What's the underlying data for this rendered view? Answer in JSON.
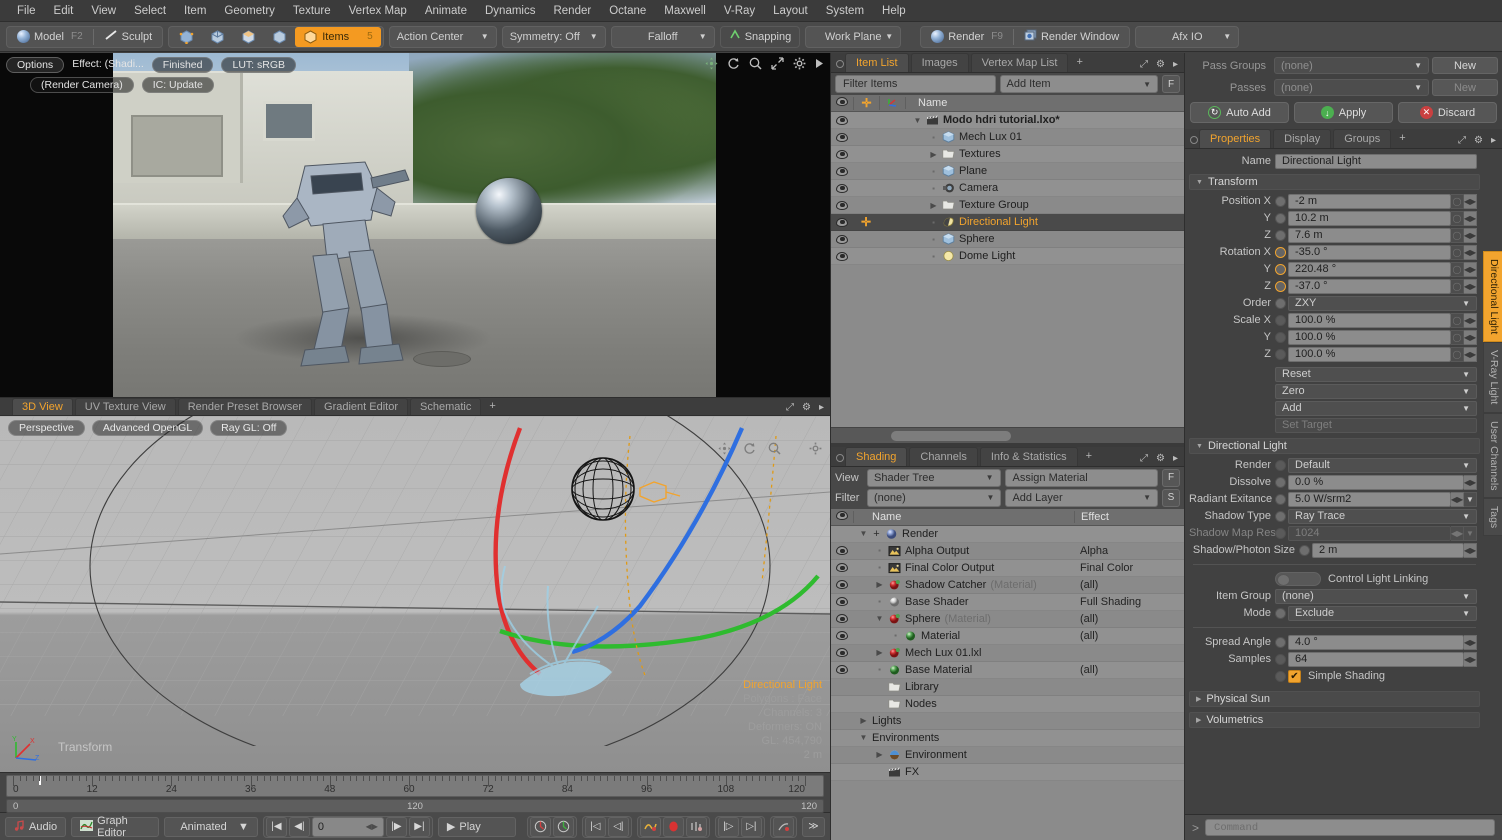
{
  "menu": {
    "items": [
      "File",
      "Edit",
      "View",
      "Select",
      "Item",
      "Geometry",
      "Texture",
      "Vertex Map",
      "Animate",
      "Dynamics",
      "Render",
      "Octane",
      "Maxwell",
      "V-Ray",
      "Layout",
      "System",
      "Help"
    ]
  },
  "toolbar": {
    "model_label": "Model",
    "model_hotkey": "F2",
    "sculpt_label": "Sculpt",
    "items_label": "Items",
    "items_count": "5",
    "action_center": "Action Center",
    "symmetry": "Symmetry: Off",
    "falloff": "Falloff",
    "snapping": "Snapping",
    "work_plane": "Work Plane",
    "render_label": "Render",
    "render_hotkey": "F9",
    "render_window_label": "Render Window",
    "afx_io": "Afx IO"
  },
  "render_preview": {
    "options": "Options",
    "effect": "Effect: (Shadi...",
    "status": "Finished",
    "lut": "LUT: sRGB",
    "camera": "(Render Camera)",
    "ic": "IC: Update"
  },
  "viewport": {
    "tabs": [
      "3D View",
      "UV Texture View",
      "Render Preset Browser",
      "Gradient Editor",
      "Schematic"
    ],
    "active_tab": "3D View",
    "add_tab": "+",
    "sub_buttons": [
      "Perspective",
      "Advanced OpenGL",
      "Ray GL: Off"
    ],
    "transform_label": "Transform",
    "info": {
      "title": "Directional Light",
      "polygons": "Polygons : Face",
      "channels": "Channels: 3",
      "deformers": "Deformers: ON",
      "gl": "GL: 454,790",
      "scale": "2 m"
    }
  },
  "timeline": {
    "ticks": [
      "0",
      "12",
      "24",
      "36",
      "48",
      "60",
      "72",
      "84",
      "96",
      "108",
      "120"
    ],
    "range_start": "0",
    "range_center": "120",
    "range_end": "120"
  },
  "statusbar": {
    "audio": "Audio",
    "graph_editor": "Graph Editor",
    "mode": "Animated",
    "frame": "0",
    "play": "Play"
  },
  "item_list": {
    "tabs": [
      "Item List",
      "Images",
      "Vertex Map List"
    ],
    "active_tab": "Item List",
    "add_tab": "+",
    "filter_placeholder": "Filter Items",
    "add_item": "Add Item",
    "f_button": "F",
    "columns": [
      "Name"
    ],
    "rows": [
      {
        "name": "Modo hdri tutorial.lxo*",
        "icon": "scene-icon",
        "depth": 0,
        "bold": true,
        "expander": "down",
        "selected": false
      },
      {
        "name": "Mech Lux 01",
        "icon": "mesh-icon",
        "depth": 1,
        "bold": false,
        "expander": "leaf",
        "selected": false
      },
      {
        "name": "Textures",
        "icon": "folder-icon",
        "depth": 1,
        "bold": false,
        "expander": "right",
        "selected": false
      },
      {
        "name": "Plane",
        "icon": "mesh-icon",
        "depth": 1,
        "bold": false,
        "expander": "leaf",
        "selected": false
      },
      {
        "name": "Camera",
        "icon": "camera-icon",
        "depth": 1,
        "bold": false,
        "expander": "leaf",
        "selected": false
      },
      {
        "name": "Texture Group",
        "icon": "folder-icon",
        "depth": 1,
        "bold": false,
        "expander": "right",
        "selected": false
      },
      {
        "name": "Directional Light",
        "icon": "light-icon",
        "depth": 1,
        "bold": false,
        "expander": "leaf",
        "selected": true
      },
      {
        "name": "Sphere",
        "icon": "mesh-icon",
        "depth": 1,
        "bold": false,
        "expander": "leaf",
        "selected": false
      },
      {
        "name": "Dome Light",
        "icon": "dome-icon",
        "depth": 1,
        "bold": false,
        "expander": "leaf",
        "selected": false
      }
    ]
  },
  "shading": {
    "tabs": [
      "Shading",
      "Channels",
      "Info & Statistics"
    ],
    "active_tab": "Shading",
    "add_tab": "+",
    "view_label": "View",
    "view_value": "Shader Tree",
    "assign_material": "Assign Material",
    "f_button": "F",
    "filter_label": "Filter",
    "filter_value": "(none)",
    "add_layer": "Add Layer",
    "s_button": "S",
    "columns": [
      "Name",
      "Effect"
    ],
    "rows": [
      {
        "name": "Render",
        "sub": "",
        "effect": "",
        "icon": "render-globe-icon",
        "depth": 0,
        "expander": "down",
        "eye": false,
        "plus": true
      },
      {
        "name": "Alpha Output",
        "sub": "",
        "effect": "Alpha",
        "icon": "image-icon",
        "depth": 1,
        "expander": "leaf",
        "eye": true
      },
      {
        "name": "Final Color Output",
        "sub": "",
        "effect": "Final Color",
        "icon": "image-icon",
        "depth": 1,
        "expander": "leaf",
        "eye": true
      },
      {
        "name": "Shadow Catcher",
        "sub": "(Material)",
        "effect": "(all)",
        "icon": "material-red-icon",
        "depth": 1,
        "expander": "right",
        "eye": true
      },
      {
        "name": "Base Shader",
        "sub": "",
        "effect": "Full Shading",
        "icon": "shader-icon",
        "depth": 1,
        "expander": "leaf",
        "eye": true
      },
      {
        "name": "Sphere",
        "sub": "(Material)",
        "effect": "(all)",
        "icon": "material-red-icon",
        "depth": 1,
        "expander": "down",
        "eye": true
      },
      {
        "name": "Material",
        "sub": "",
        "effect": "(all)",
        "icon": "material-green-icon",
        "depth": 2,
        "expander": "leaf",
        "eye": true
      },
      {
        "name": "Mech Lux 01.lxl",
        "sub": "",
        "effect": "",
        "icon": "material-red-icon",
        "depth": 1,
        "expander": "right",
        "eye": true
      },
      {
        "name": "Base Material",
        "sub": "",
        "effect": "(all)",
        "icon": "material-green-icon",
        "depth": 1,
        "expander": "leaf",
        "eye": true
      },
      {
        "name": "Library",
        "sub": "",
        "effect": "",
        "icon": "folder-icon",
        "depth": 1,
        "expander": "none",
        "eye": false
      },
      {
        "name": "Nodes",
        "sub": "",
        "effect": "",
        "icon": "folder-icon",
        "depth": 1,
        "expander": "none",
        "eye": false
      },
      {
        "name": "Lights",
        "sub": "",
        "effect": "",
        "icon": "none",
        "depth": 0,
        "expander": "right",
        "eye": false
      },
      {
        "name": "Environments",
        "sub": "",
        "effect": "",
        "icon": "none",
        "depth": 0,
        "expander": "down",
        "eye": false
      },
      {
        "name": "Environment",
        "sub": "",
        "effect": "",
        "icon": "env-icon",
        "depth": 1,
        "expander": "right",
        "eye": false
      },
      {
        "name": "FX",
        "sub": "",
        "effect": "",
        "icon": "scene-icon",
        "depth": 1,
        "expander": "none",
        "eye": false
      }
    ]
  },
  "properties": {
    "pass_groups_label": "Pass Groups",
    "pass_groups_value": "(none)",
    "pass_groups_new": "New",
    "passes_label": "Passes",
    "passes_value": "(none)",
    "passes_new": "New",
    "auto_add": "Auto Add",
    "apply": "Apply",
    "discard": "Discard",
    "tabs": [
      "Properties",
      "Display",
      "Groups"
    ],
    "active_tab": "Properties",
    "add_tab": "+",
    "name_label": "Name",
    "name_value": "Directional Light",
    "transform_title": "Transform",
    "transform": [
      {
        "label": "Position X",
        "value": "-2 m",
        "knob": "normal"
      },
      {
        "label": "Y",
        "value": "10.2 m",
        "knob": "normal"
      },
      {
        "label": "Z",
        "value": "7.6 m",
        "knob": "normal"
      },
      {
        "label": "Rotation X",
        "value": "-35.0 °",
        "knob": "on"
      },
      {
        "label": "Y",
        "value": "220.48 °",
        "knob": "on"
      },
      {
        "label": "Z",
        "value": "-37.0 °",
        "knob": "on"
      }
    ],
    "order_label": "Order",
    "order_value": "ZXY",
    "scale": [
      {
        "label": "Scale X",
        "value": "100.0 %"
      },
      {
        "label": "Y",
        "value": "100.0 %"
      },
      {
        "label": "Z",
        "value": "100.0 %"
      }
    ],
    "reset": "Reset",
    "zero": "Zero",
    "add": "Add",
    "set_target": "Set Target",
    "light_title": "Directional Light",
    "render_label": "Render",
    "render_value": "Default",
    "dissolve_label": "Dissolve",
    "dissolve_value": "0.0 %",
    "radiant_label": "Radiant Exitance",
    "radiant_value": "5.0 W/srm2",
    "shadow_type_label": "Shadow Type",
    "shadow_type_value": "Ray Trace",
    "shadow_map_label": "Shadow Map Res",
    "shadow_map_value": "1024",
    "shadow_photon_label": "Shadow/Photon Size",
    "shadow_photon_value": "2 m",
    "control_light_linking": "Control Light Linking",
    "item_group_label": "Item Group",
    "item_group_value": "(none)",
    "mode_label": "Mode",
    "mode_value": "Exclude",
    "spread_label": "Spread Angle",
    "spread_value": "4.0 °",
    "samples_label": "Samples",
    "samples_value": "64",
    "simple_shading": "Simple Shading",
    "physical_sun": "Physical Sun",
    "volumetrics": "Volumetrics",
    "vertical_tabs": [
      "Directional Light",
      "V-Ray Light",
      "User Channels",
      "Tags"
    ],
    "vertical_active": "Directional Light"
  },
  "command": {
    "prompt": ">",
    "placeholder": "Command"
  },
  "colors": {
    "accent": "#f2a42e",
    "panel": "#414141",
    "tree_bg": "#8b8b8b",
    "axis_x": "#e03030",
    "axis_y": "#2fbb2f",
    "axis_z": "#2f6fe0"
  }
}
